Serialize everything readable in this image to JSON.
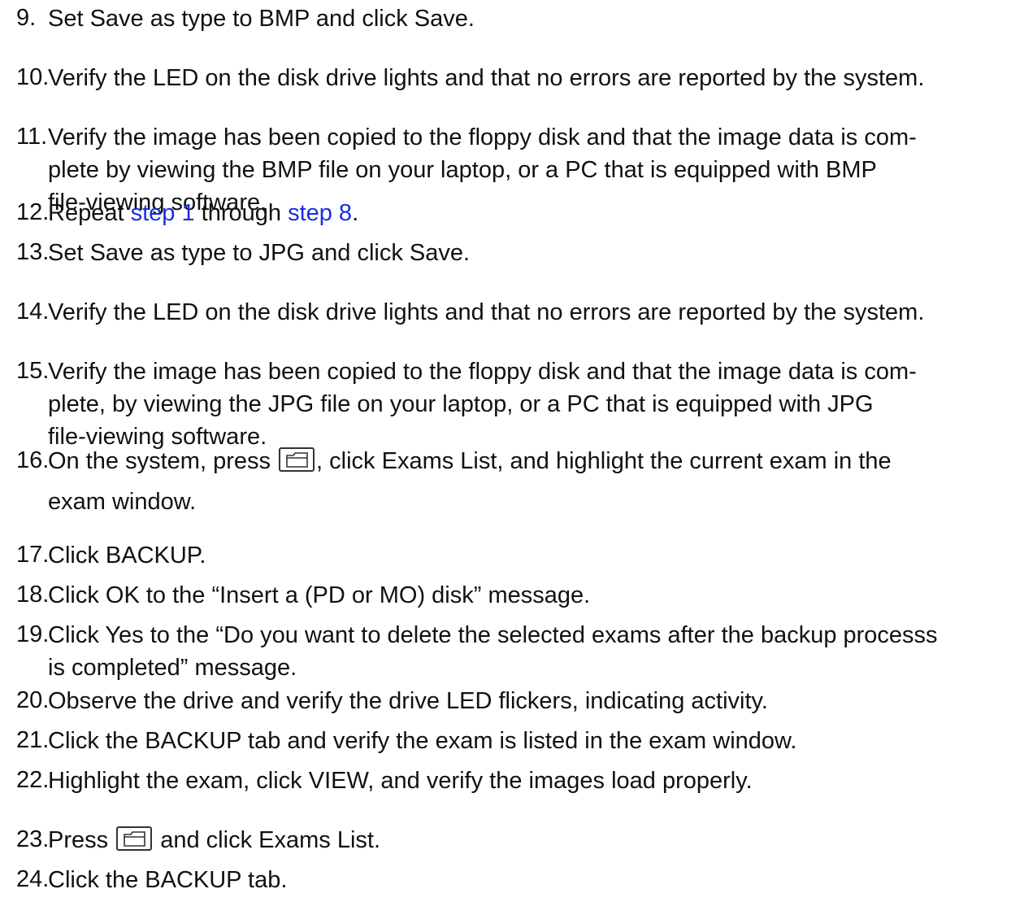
{
  "steps": [
    {
      "number": "9.",
      "lines": [
        "Set Save as type to BMP and click Save."
      ]
    },
    {
      "number": "10.",
      "lines": [
        "Verify the LED on the disk drive lights and that no errors are reported by the system."
      ]
    },
    {
      "number": "11.",
      "lines": [
        "Verify the image has been copied to the floppy disk and that the image data is com-",
        "plete by viewing the BMP file on your laptop, or a PC that is equipped with BMP",
        "file-viewing software."
      ]
    },
    {
      "number": "12.",
      "pre": "Repeat ",
      "link1": "step 1",
      "mid": " through ",
      "link2": "step 8",
      "post": "."
    },
    {
      "number": "13.",
      "lines": [
        "Set Save as type to JPG and click Save."
      ]
    },
    {
      "number": "14.",
      "lines": [
        "Verify the LED on the disk drive lights and that no errors are reported by the system."
      ]
    },
    {
      "number": "15.",
      "lines": [
        "Verify the image has been copied to the floppy disk and that the image data is com-",
        "plete, by viewing the JPG file on your laptop, or a PC that is equipped with JPG",
        "file-viewing software."
      ]
    },
    {
      "number": "16.",
      "pre": "On the system, press ",
      "post": ", click Exams List, and highlight the current exam in the",
      "line2": "exam window."
    },
    {
      "number": "17.",
      "lines": [
        "Click BACKUP."
      ]
    },
    {
      "number": "18.",
      "lines": [
        "Click OK to the “Insert a (PD or MO) disk” message."
      ]
    },
    {
      "number": "19.",
      "lines": [
        "Click Yes to the “Do you want to delete the selected exams after the backup processs",
        "is completed” message."
      ]
    },
    {
      "number": "20.",
      "lines": [
        "Observe the drive and verify the drive LED flickers, indicating activity."
      ]
    },
    {
      "number": "21.",
      "lines": [
        "Click the BACKUP tab and verify the exam is listed in the exam window."
      ]
    },
    {
      "number": "22.",
      "lines": [
        "Highlight the exam, click VIEW, and verify the images load properly."
      ]
    },
    {
      "number": "23.",
      "pre": "Press ",
      "post": " and click Exams List."
    },
    {
      "number": "24.",
      "lines": [
        "Click the BACKUP tab."
      ]
    }
  ]
}
